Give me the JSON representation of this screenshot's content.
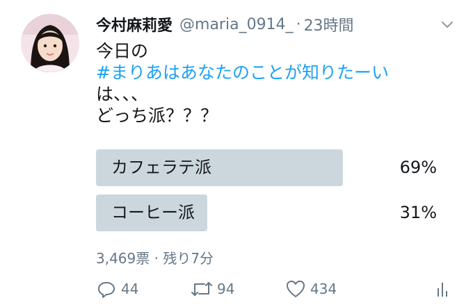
{
  "tweet": {
    "author_name": "今村麻莉愛",
    "handle": "@maria_0914_",
    "separator": "·",
    "time": "23時間",
    "text_lines": [
      "今日の",
      "#まりあはあなたのことが知りたーい",
      "は、、、",
      "どっち派？？？"
    ],
    "hashtag_line_index": 1
  },
  "poll": {
    "options": [
      {
        "label": "カフェラテ派",
        "percent": 69,
        "percent_label": "69%"
      },
      {
        "label": "コーヒー派",
        "percent": 31,
        "percent_label": "31%"
      }
    ],
    "meta": "3,469票 · 残り7分"
  },
  "actions": {
    "reply_count": "44",
    "retweet_count": "94",
    "like_count": "434"
  },
  "icons": {
    "menu": "chevron-down-icon",
    "reply": "reply-icon",
    "retweet": "retweet-icon",
    "like": "heart-icon",
    "analytics": "analytics-icon"
  },
  "colors": {
    "hashtag": "#1da1f2",
    "poll_bar": "#ccd6dd",
    "secondary_text": "#657786"
  }
}
